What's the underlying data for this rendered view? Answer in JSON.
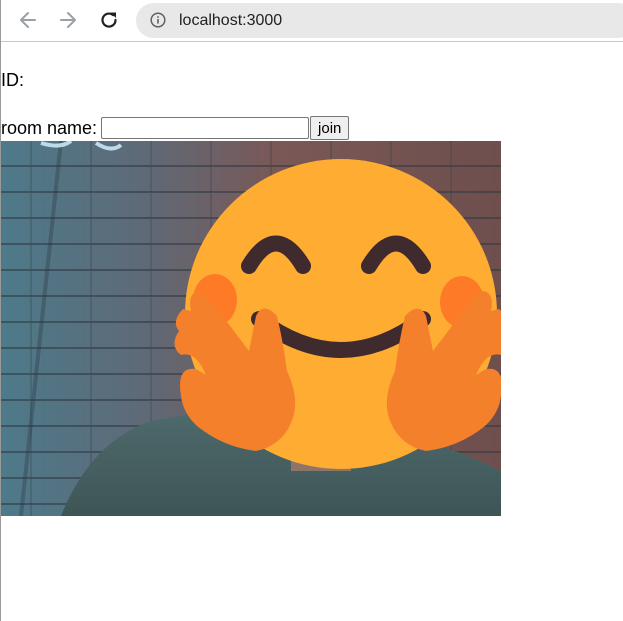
{
  "browser": {
    "url": "localhost:3000",
    "icons": {
      "back": "arrow-left-icon",
      "forward": "arrow-right-icon",
      "reload": "reload-icon",
      "info": "info-icon"
    }
  },
  "page": {
    "id_label": "ID:",
    "room_label": "room name:",
    "room_input_value": "",
    "join_label": "join"
  },
  "video": {
    "overlay_icon": "hugging-face-emoji-icon",
    "colors": {
      "emoji_face": "#FFAC33",
      "emoji_hands": "#F4802B",
      "emoji_cheeks": "#FF7A27",
      "emoji_features": "#3F2A2E"
    }
  }
}
